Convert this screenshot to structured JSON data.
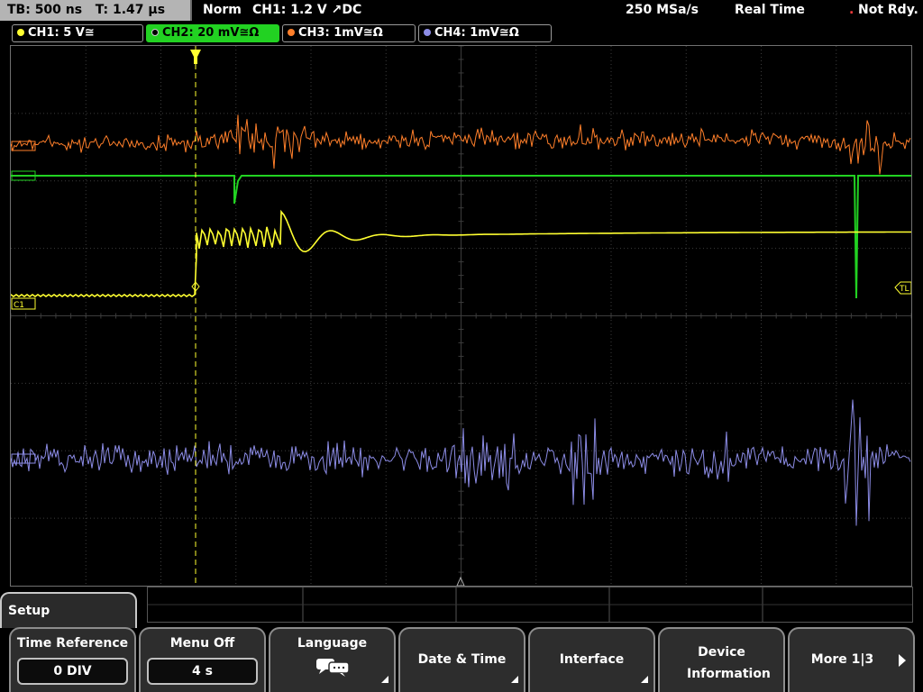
{
  "status_bar": {
    "timebase": "TB: 500 ns",
    "trigger_time": "T: 1.47 µs",
    "mode": "Norm",
    "trigger": "CH1: 1.2 V ↗DC",
    "sample_rate": "250 MSa/s",
    "acquisition": "Real Time",
    "state": "Not Rdy."
  },
  "channels": [
    {
      "label": "CH1: 5 V≅",
      "color": "#ffff30"
    },
    {
      "label": "CH2: 20 mV≅Ω",
      "color": "#22d222"
    },
    {
      "label": "CH3: 1mV≅Ω",
      "color": "#ff7f2a"
    },
    {
      "label": "CH4: 1mV≅Ω",
      "color": "#8c8ce6"
    }
  ],
  "markers": {
    "ch1": "C1",
    "trigger_level": "TL"
  },
  "menu_title": "Setup",
  "softkeys": [
    {
      "label": "Time Reference",
      "value": "0 DIV"
    },
    {
      "label": "Menu Off",
      "value": "4 s"
    },
    {
      "label": "Language",
      "icon": "speech-bubbles-icon"
    },
    {
      "label": "Date & Time"
    },
    {
      "label": "Interface"
    },
    {
      "label": "Device Information"
    },
    {
      "label": "More 1|3"
    }
  ],
  "colors": {
    "grid": "#3c3c3c",
    "trigger": "#ffff30",
    "ch1": "#ffff30",
    "ch2": "#22d222",
    "ch3": "#ff7f2a",
    "ch4": "#8c8ce6"
  }
}
